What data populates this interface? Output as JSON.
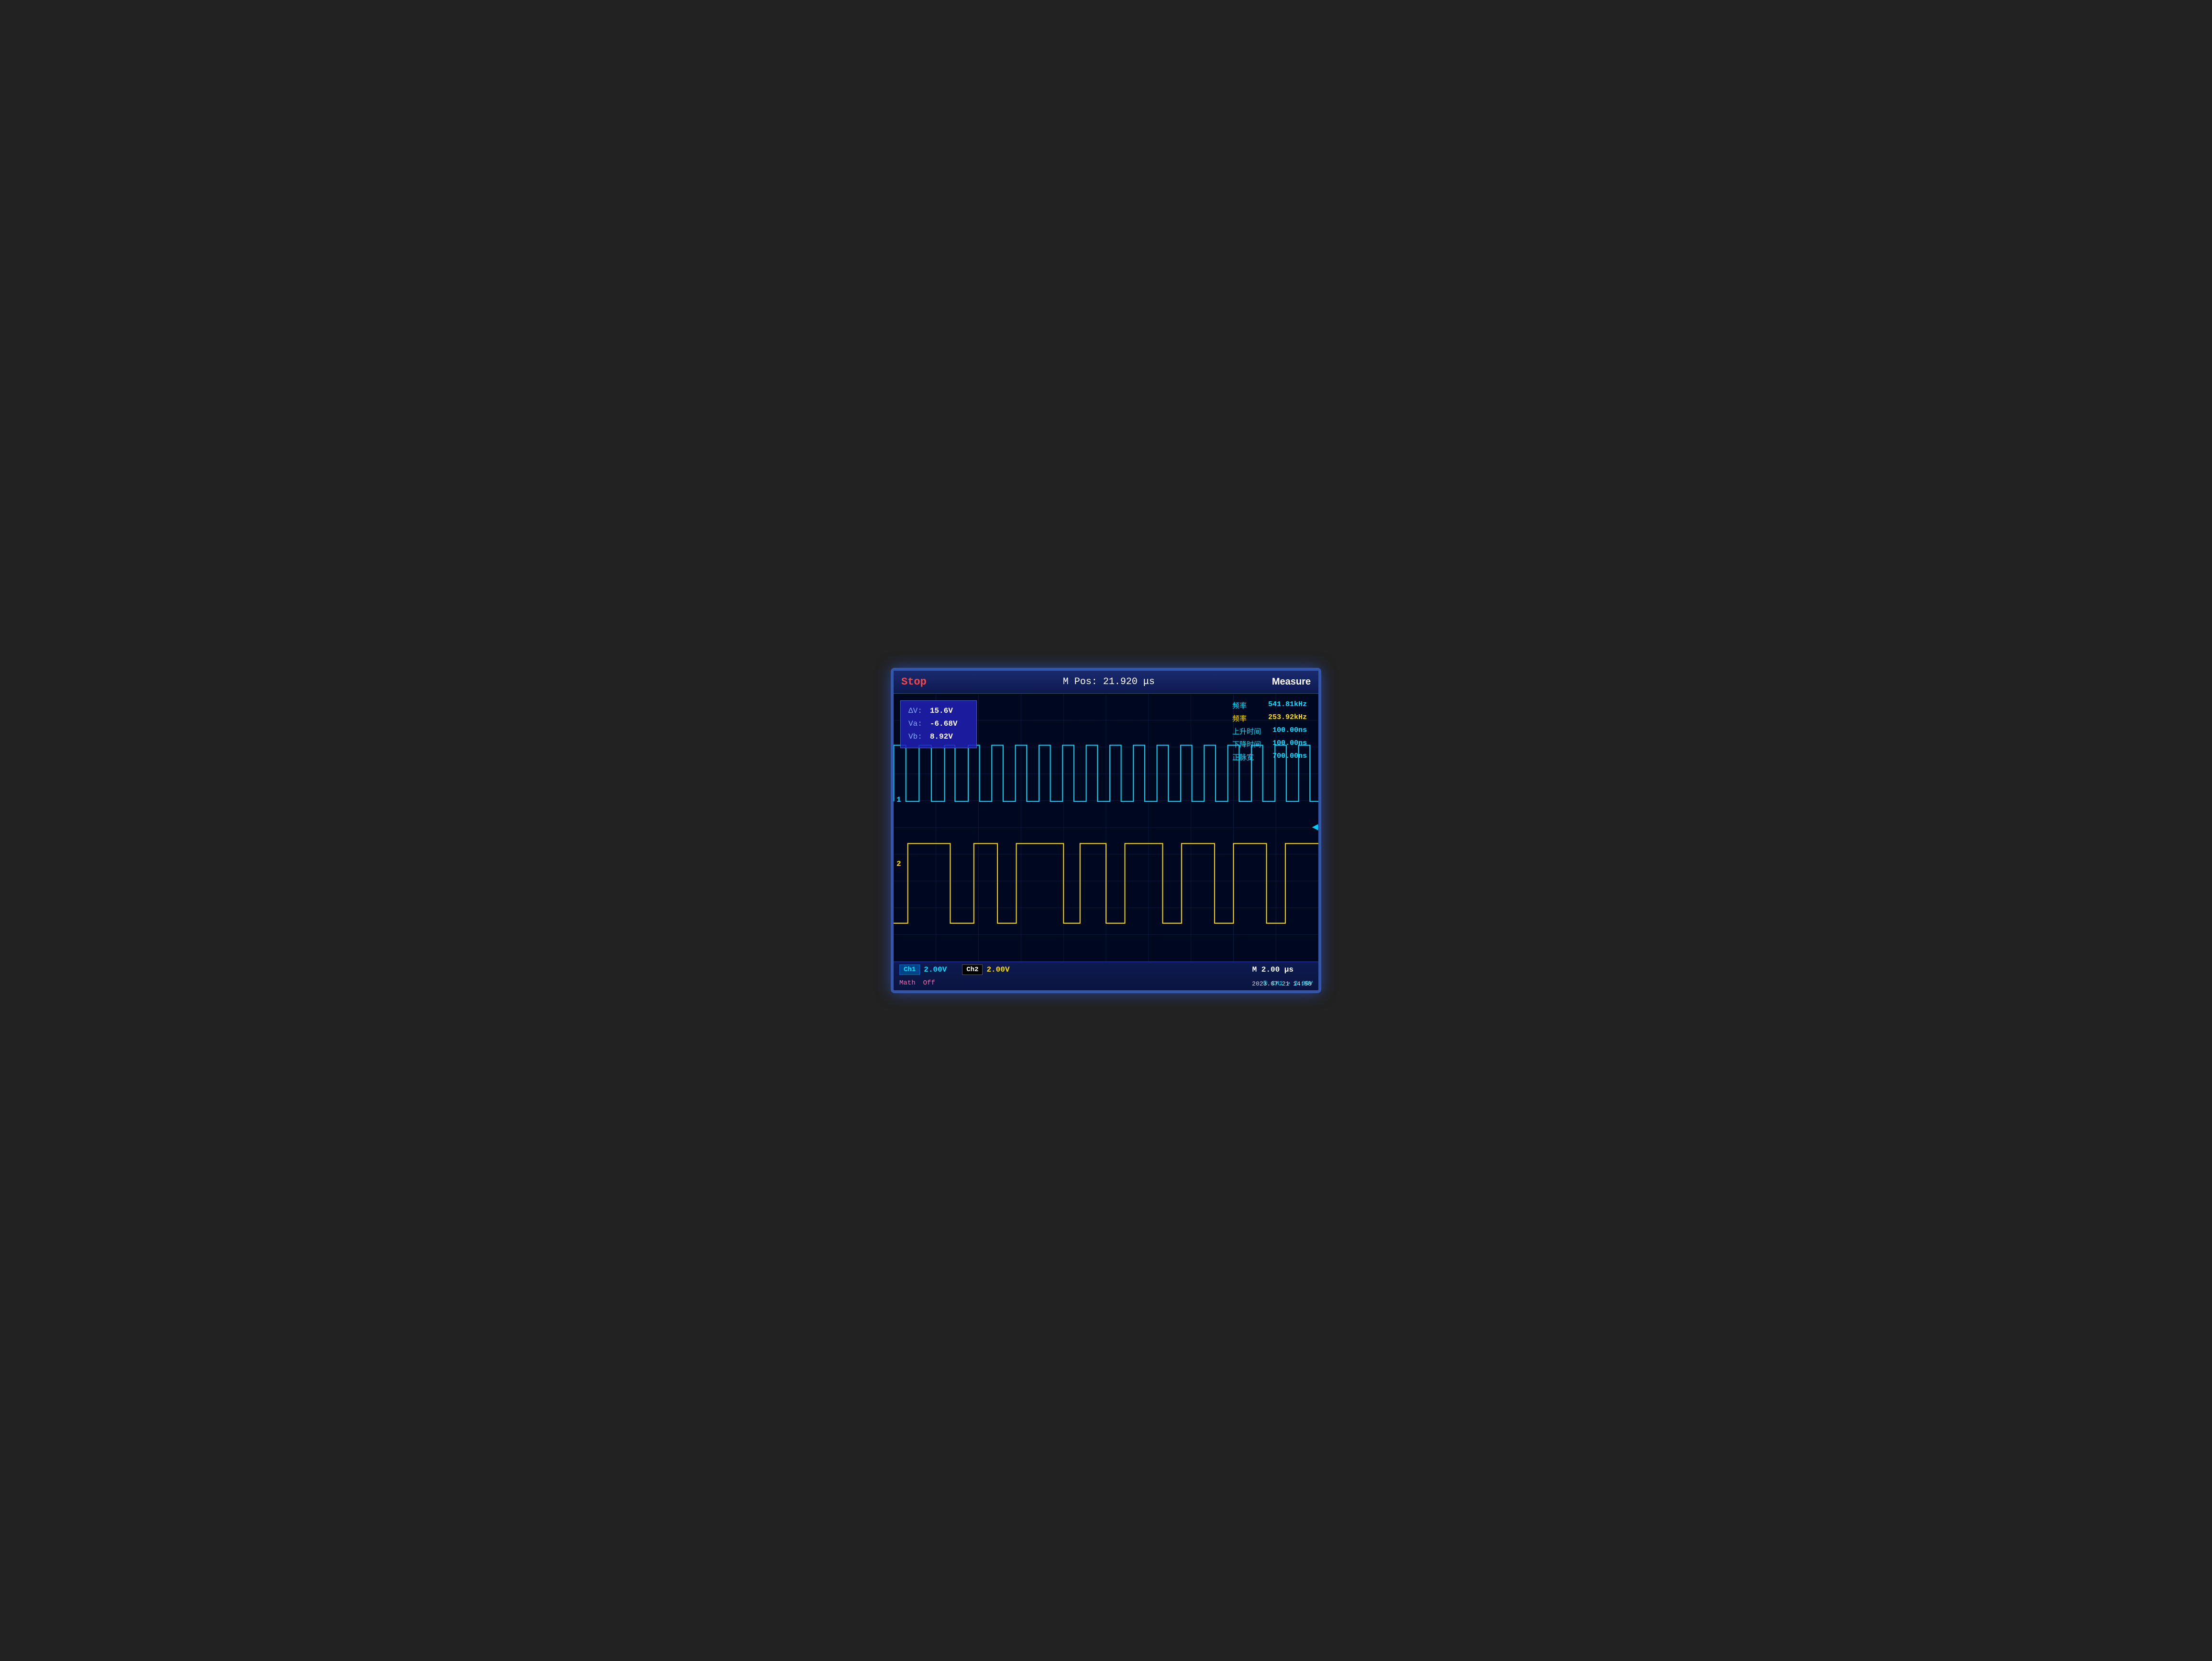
{
  "header": {
    "status": "Stop",
    "m_pos_label": "M Pos:",
    "m_pos_value": "21.920 μs",
    "measure_button": "Measure"
  },
  "measurement_box": {
    "dv_label": "ΔV:",
    "dv_value": "15.6V",
    "va_label": "Va:",
    "va_value": "-6.68V",
    "vb_label": "Vb:",
    "vb_value": "8.92V"
  },
  "right_measurements": [
    {
      "label": "频率",
      "value": "541.81kHz",
      "color": "cyan"
    },
    {
      "label": "频率",
      "value": "253.92kHz",
      "color": "yellow"
    },
    {
      "label": "上升时间",
      "value": "100.00ns",
      "color": "cyan"
    },
    {
      "label": "下降时间",
      "value": "100.00ns",
      "color": "cyan"
    },
    {
      "label": "正脉宽",
      "value": "700.00ns",
      "color": "cyan"
    }
  ],
  "bottom_bar": {
    "ch1_label": "Ch1",
    "ch1_volt": "2.00V",
    "ch2_label": "Ch2",
    "ch2_volt": "2.00V",
    "time_label": "M 2.00 μs",
    "math_label": "Math",
    "math_status": "Off",
    "trigger_info": "① CH1 ↗ 2.08V"
  },
  "channel_indicators": {
    "ch1": "1",
    "ch2": "2"
  },
  "timestamp": "2023.07.21 14:58",
  "colors": {
    "ch1_color": "#00ddff",
    "ch2_color": "#ffdd00",
    "background": "#000820",
    "grid": "#1a2a5a",
    "header_bg": "#1a2a6e"
  }
}
